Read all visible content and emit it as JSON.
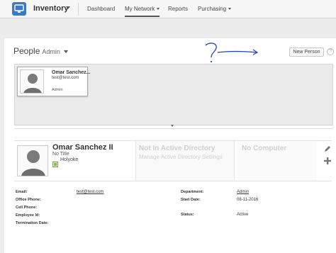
{
  "nav": {
    "app_title": "Inventory",
    "items": [
      {
        "label": "Dashboard"
      },
      {
        "label": "My Network"
      },
      {
        "label": "Reports"
      },
      {
        "label": "Purchasing"
      }
    ]
  },
  "page": {
    "title": "People",
    "subtitle": "Admin",
    "new_person_label": "New Person",
    "help_label": "?"
  },
  "annotation": {
    "text": "?"
  },
  "card": {
    "name": "Omar Sanchez...",
    "email": "test@test.com",
    "role": "Admin"
  },
  "detail": {
    "name": "Omar Sanchez II",
    "title": "No Title",
    "location": "Holyoke",
    "ad_title": "Not In Active Directory",
    "ad_sub": "Manage Active Directory Settings",
    "computer": "No Computer"
  },
  "fields": {
    "email_label": "Email:",
    "email_value": "test@test.com",
    "office_phone_label": "Office Phone:",
    "cell_phone_label": "Cell Phone:",
    "employee_id_label": "Employee Id:",
    "termination_date_label": "Termination Date:",
    "department_label": "Department:",
    "department_value": "Admin",
    "start_date_label": "Start Date:",
    "start_date_value": "08-11-2016",
    "status_label": "Status:",
    "status_value": "Active"
  },
  "colors": {
    "accent": "#3a78c8",
    "annotation": "#1f3fc7"
  },
  "icons": [
    "monitor-icon",
    "help-icon",
    "location-icon",
    "pencil-icon",
    "plus-icon",
    "avatar"
  ]
}
